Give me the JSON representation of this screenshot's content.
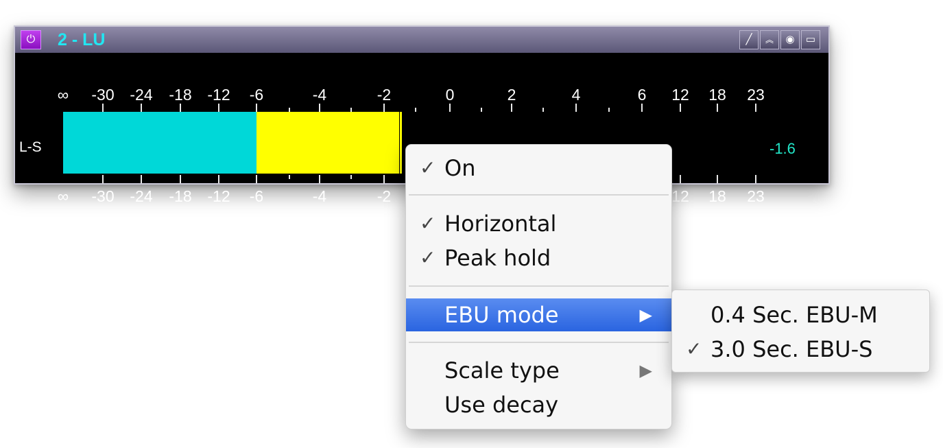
{
  "window": {
    "title": "2 - LU",
    "power_icon": "power-icon",
    "titlebar_icons": [
      "pencil-icon",
      "chevron-up-icon",
      "eye-icon",
      "maximize-icon"
    ],
    "colors": {
      "title": "#22e6f2",
      "power_button": "#b030e0",
      "background": "#000000"
    }
  },
  "meter": {
    "scale_labels": [
      "∞",
      "-30",
      "-24",
      "-18",
      "-12",
      "-6",
      "-4",
      "-2",
      "0",
      "2",
      "4",
      "6",
      "12",
      "18",
      "23"
    ],
    "channel_label": "L-S",
    "readout": "-1.6",
    "colors": {
      "low_segment": "#00d8d8",
      "high_segment": "#ffff00",
      "readout": "#22e6c8"
    }
  },
  "context_menu": {
    "items": [
      {
        "label": "On",
        "checked": true
      },
      {
        "label": "Horizontal",
        "checked": true
      },
      {
        "label": "Peak hold",
        "checked": true
      },
      {
        "label": "EBU mode",
        "checked": false,
        "has_submenu": true,
        "highlighted": true
      },
      {
        "label": "Scale type",
        "checked": false,
        "has_submenu": true
      },
      {
        "label": "Use decay",
        "checked": false
      }
    ],
    "check_glyph": "✓",
    "arrow_glyph": "▶"
  },
  "submenu": {
    "items": [
      {
        "label": "0.4 Sec. EBU-M",
        "checked": false
      },
      {
        "label": "3.0 Sec. EBU-S",
        "checked": true
      }
    ]
  }
}
